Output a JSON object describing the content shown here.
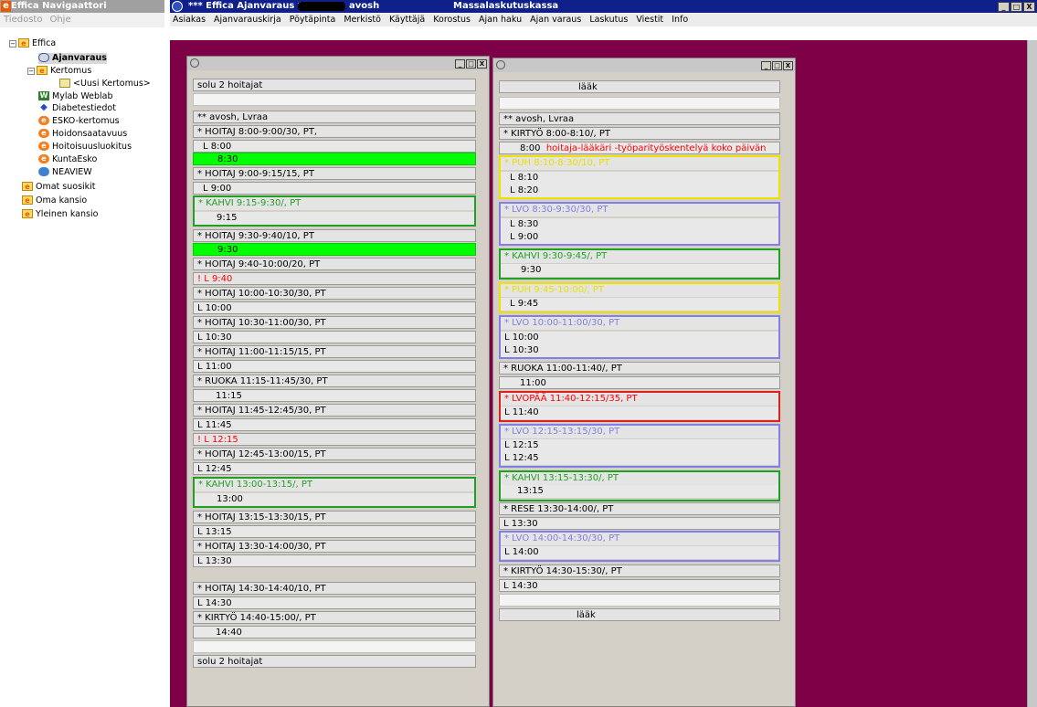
{
  "navigator": {
    "title": "Effica Navigaattori",
    "menu": [
      "Tiedosto",
      "Ohje"
    ],
    "tree": [
      {
        "label": "Effica"
      },
      {
        "label": "Ajanvaraus"
      },
      {
        "label": "Kertomus"
      },
      {
        "label": "<Uusi Kertomus>"
      },
      {
        "label": "Mylab Weblab"
      },
      {
        "label": "Diabetestiedot"
      },
      {
        "label": "ESKO-kertomus"
      },
      {
        "label": "Hoidonsaatavuus"
      },
      {
        "label": "Hoitoisuusluokitus"
      },
      {
        "label": "KuntaEsko"
      },
      {
        "label": "NEAVIEW"
      },
      {
        "label": "Omat suosikit"
      },
      {
        "label": "Oma kansio"
      },
      {
        "label": "Yleinen kansio"
      }
    ]
  },
  "main": {
    "title": "*** Effica Ajanvaraus ***",
    "title_name": "avosh",
    "title_right": "Massalaskutuskassa",
    "menu": [
      "Asiakas",
      "Ajanvarauskirja",
      "Pöytäpinta",
      "Merkistö",
      "Käyttäjä",
      "Korostus",
      "Ajan haku",
      "Ajan varaus",
      "Laskutus",
      "Viestit",
      "Info"
    ],
    "window_buttons": [
      "_",
      "□",
      "X"
    ]
  },
  "left_window": {
    "rows": [
      "solu 2 hoitajat",
      "",
      "** avosh, Lvraa",
      "* HOITAJ  8:00-9:00/30, PT,",
      "L  8:00",
      "8:30",
      "* HOITAJ  9:00-9:15/15, PT",
      "L  9:00",
      "* KAHVI  9:15-9:30/, PT",
      "9:15",
      "* HOITAJ  9:30-9:40/10, PT",
      "9:30",
      "* HOITAJ  9:40-10:00/20, PT",
      "! L  9:40",
      "* HOITAJ  10:00-10:30/30, PT",
      "L 10:00",
      "* HOITAJ  10:30-11:00/30, PT",
      "L 10:30",
      "* HOITAJ  11:00-11:15/15, PT",
      "L 11:00",
      "* RUOKA  11:15-11:45/30, PT",
      "11:15",
      "* HOITAJ  11:45-12:45/30, PT",
      "L 11:45",
      "! L  12:15",
      "* HOITAJ  12:45-13:00/15, PT",
      "L 12:45",
      "* KAHVI  13:00-13:15/, PT",
      "13:00",
      "* HOITAJ  13:15-13:30/15, PT",
      "L 13:15",
      "* HOITAJ  13:30-14:00/30, PT",
      "L 13:30",
      "* HOITAJ  14:30-14:40/10, PT",
      "L 14:30",
      "* KIRTYÖ  14:40-15:00/, PT",
      "14:40",
      "solu 2 hoitajat"
    ]
  },
  "right_window": {
    "rows": [
      "lääk",
      "** avosh, Lvraa",
      "* KIRTYÖ  8:00-8:10/, PT",
      "8:00",
      "hoitaja-lääkäri -työparityöskentelyä koko päivän",
      "* PUH  8:10-8:30/10, PT",
      "L  8:10",
      "L  8:20",
      "* LVO  8:30-9:30/30, PT",
      "L  8:30",
      "L  9:00",
      "* KAHVI  9:30-9:45/, PT",
      "9:30",
      "* PUH  9:45-10:00/, PT",
      "L  9:45",
      "* LVO  10:00-11:00/30, PT",
      "L 10:00",
      "L 10:30",
      "* RUOKA  11:00-11:40/, PT",
      "11:00",
      "* LVOPÄÄ  11:40-12:15/35, PT",
      "L 11:40",
      "* LVO  12:15-13:15/30, PT",
      "L 12:15",
      "L 12:45",
      "* KAHVI  13:15-13:30/, PT",
      "13:15",
      "* RESE  13:30-14:00/, PT",
      "L 13:30",
      "* LVO  14:00-14:30/30, PT",
      "L 14:00",
      "* KIRTYÖ  14:30-15:30/, PT",
      "L 14:30",
      "lääk"
    ]
  },
  "colors": {
    "desktop": "#7e0047",
    "title_bar": "#10208a",
    "free_slot": "#00ff00",
    "coffee": "#20a020",
    "phone": "#f0e000",
    "appointment": "#8080e8",
    "warning": "#ff0000"
  }
}
